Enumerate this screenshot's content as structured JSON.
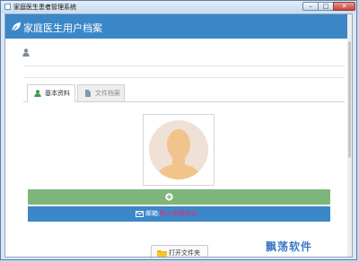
{
  "window": {
    "title": "家庭医生患者管理系统",
    "minimize_glyph": "–",
    "maximize_glyph": "□",
    "close_glyph": "✕"
  },
  "header": {
    "title": "家庭医生用户档案"
  },
  "tabs": [
    {
      "label": "基本资料",
      "active": true,
      "icon": "user-icon"
    },
    {
      "label": "文件档案",
      "active": false,
      "icon": "file-icon"
    }
  ],
  "avatar": {
    "icon": "person-avatar"
  },
  "add_button": {
    "icon": "plus-circle-icon"
  },
  "email": {
    "label": "邮箱:",
    "placeholder": "输入邮箱地址",
    "value": "",
    "icon": "envelope-icon"
  },
  "folder_button": {
    "label": "打开文件夹",
    "icon": "folder-icon"
  },
  "watermark": {
    "text": "飘荡软件"
  },
  "colors": {
    "header": "#3b87c8",
    "add_button": "#7fb57a",
    "email_bar": "#3b87c8",
    "email_placeholder": "#e0307a",
    "watermark": "#3d78c8"
  }
}
